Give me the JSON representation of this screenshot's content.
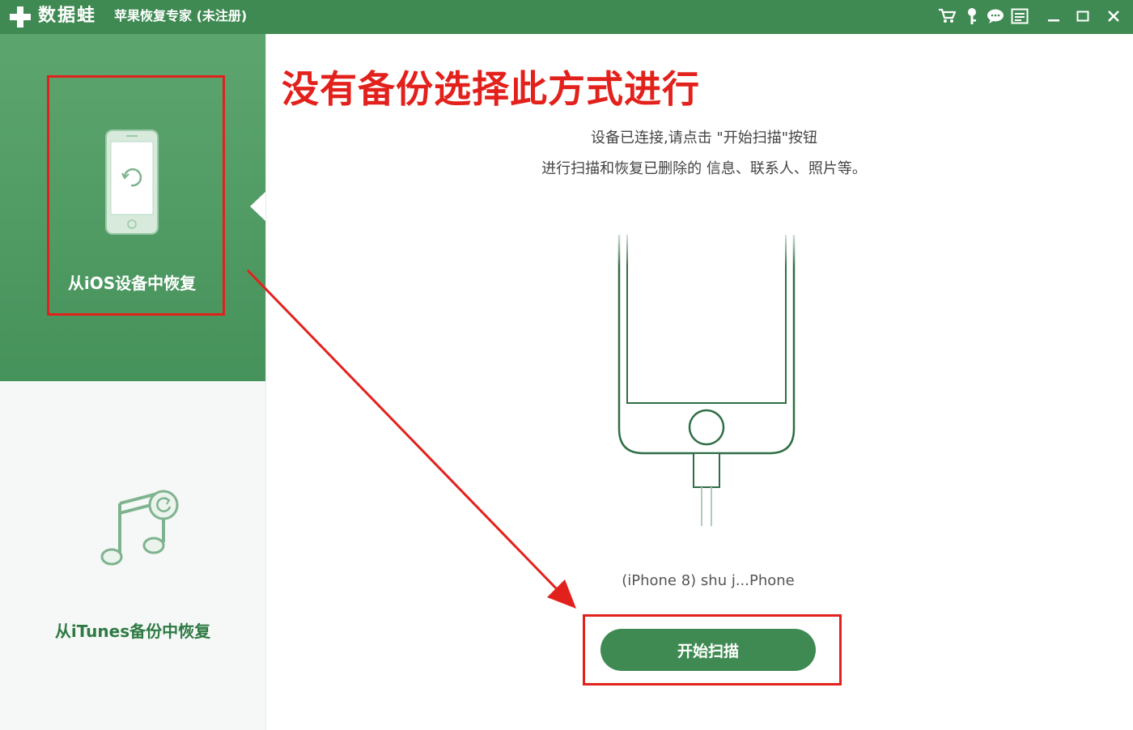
{
  "titlebar": {
    "logo_text": "数据蛙",
    "app_title": "苹果恢复专家 (未注册)",
    "icons": [
      "cart-icon",
      "key-icon",
      "chat-icon",
      "menu-icon",
      "minimize-icon",
      "maximize-icon",
      "close-icon"
    ]
  },
  "sidebar": {
    "items": [
      {
        "label": "从iOS设备中恢复",
        "icon": "iphone-restore-icon",
        "selected": true
      },
      {
        "label": "从iTunes备份中恢复",
        "icon": "music-note-icon",
        "selected": false
      }
    ]
  },
  "main": {
    "headline": "没有备份选择此方式进行",
    "description_line1": "设备已连接,请点击 \"开始扫描\"按钮",
    "description_line2": "进行扫描和恢复已删除的 信息、联系人、照片等。",
    "device_name": "(iPhone 8) shu j...Phone",
    "start_button_label": "开始扫描"
  },
  "colors": {
    "brand_green": "#3f8a52",
    "annotation_red": "#e3211c"
  }
}
